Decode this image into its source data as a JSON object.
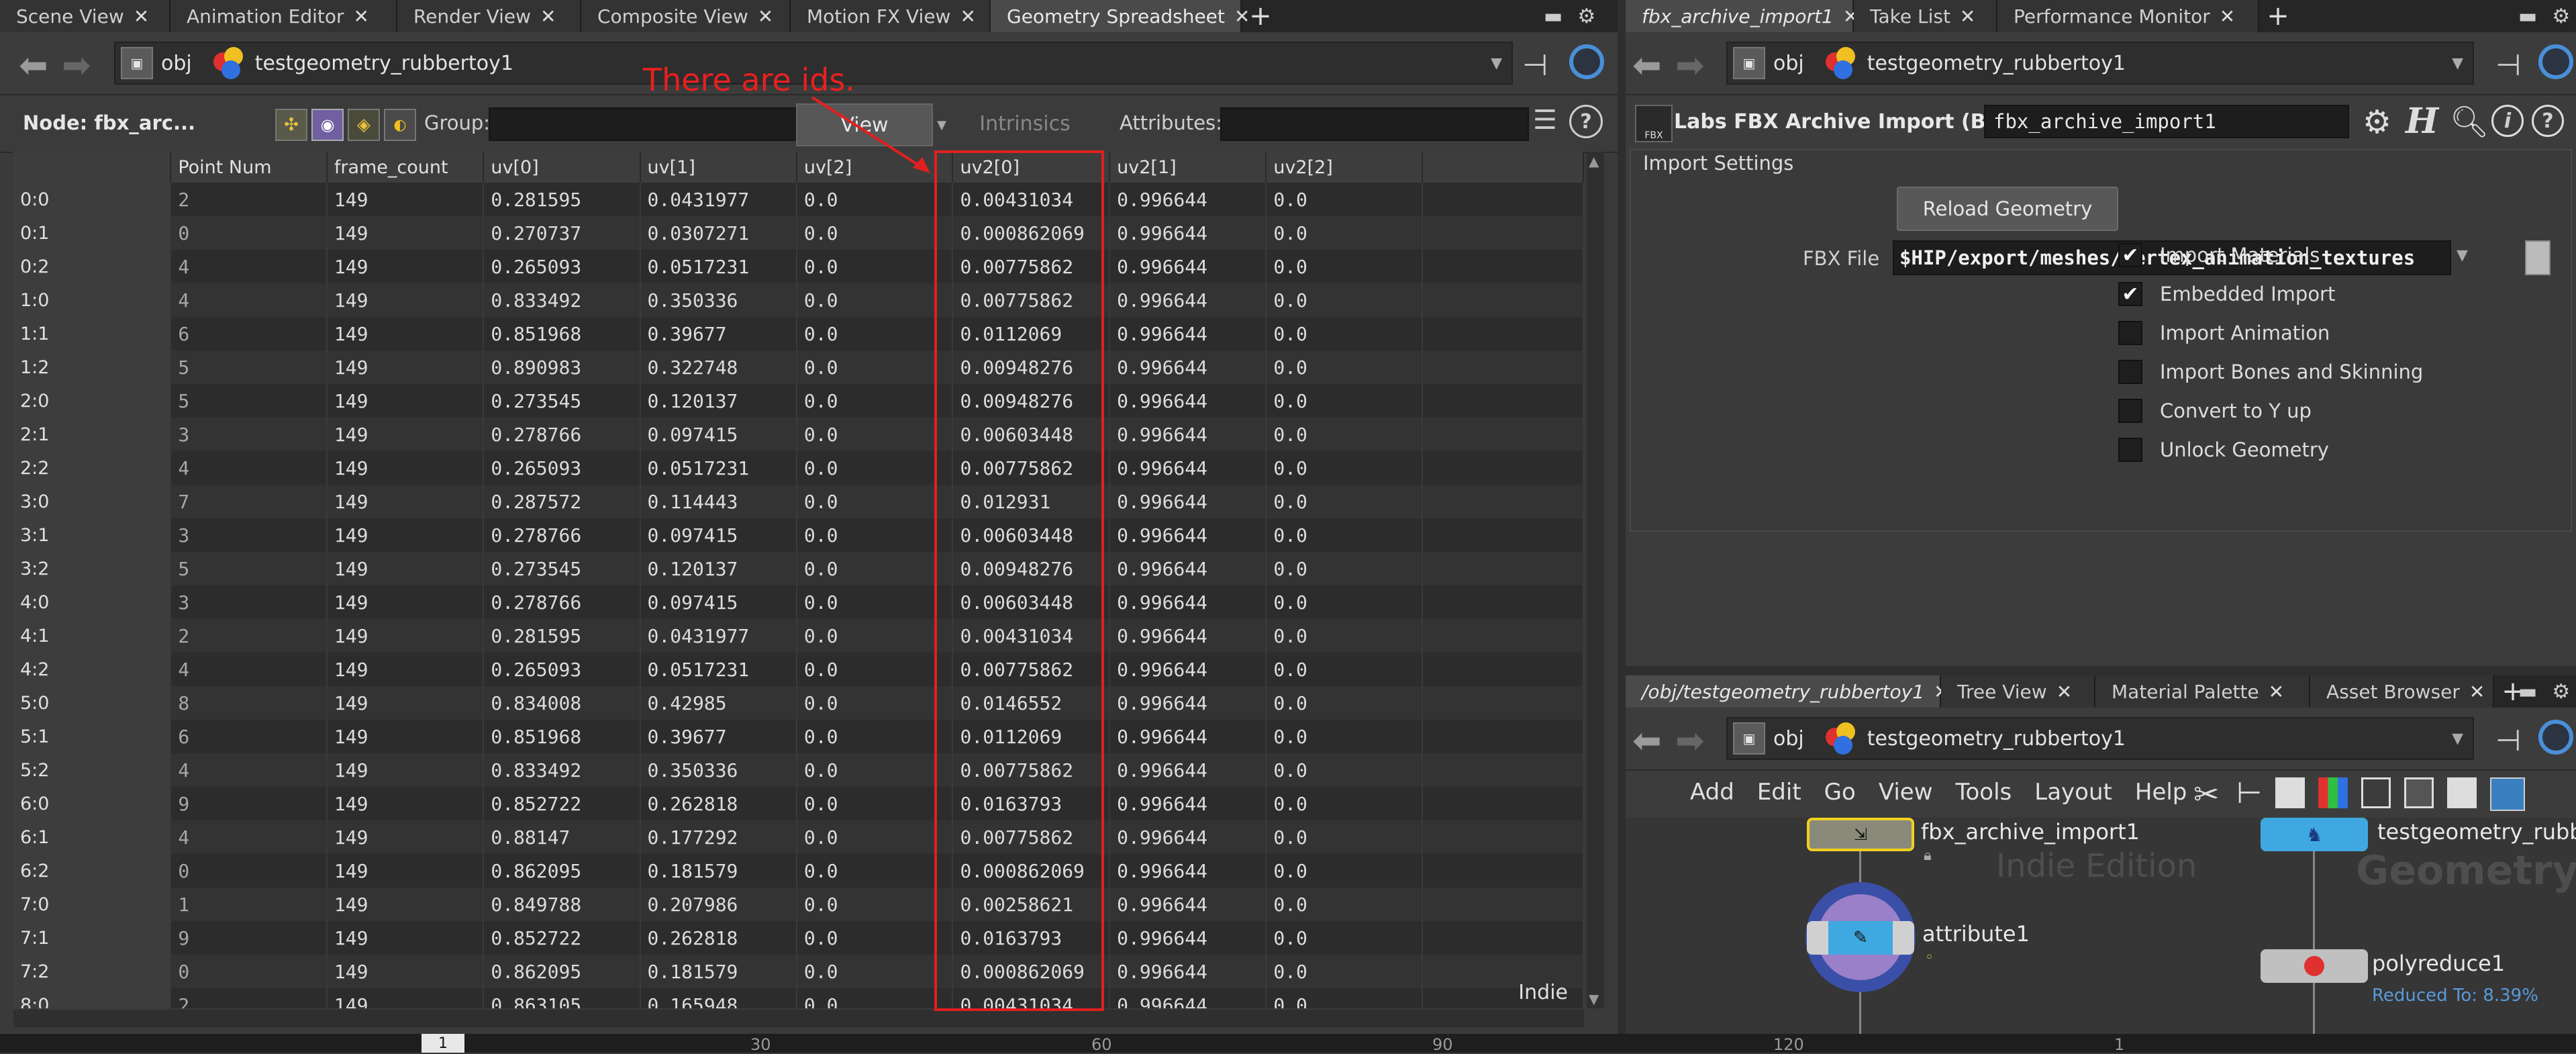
{
  "left": {
    "tabs": [
      {
        "label": "Scene View",
        "active": false
      },
      {
        "label": "Animation Editor",
        "active": false
      },
      {
        "label": "Render View",
        "active": false
      },
      {
        "label": "Composite View",
        "active": false
      },
      {
        "label": "Motion FX View",
        "active": false
      },
      {
        "label": "Geometry Spreadsheet",
        "active": true
      }
    ],
    "path": {
      "root": "obj",
      "node": "testgeometry_rubbertoy1"
    },
    "toolbar": {
      "node_label": "Node: fbx_arc...",
      "group_label": "Group:",
      "group_value": "",
      "view_label": "View",
      "intrinsics_label": "Intrinsics",
      "attributes_label": "Attributes:",
      "attributes_value": ""
    },
    "columns": [
      "",
      "Point Num",
      "frame_count",
      "uv[0]",
      "uv[1]",
      "uv[2]",
      "uv2[0]",
      "uv2[1]",
      "uv2[2]"
    ],
    "rows": [
      [
        "0:0",
        "2",
        "149",
        "0.281595",
        "0.0431977",
        "0.0",
        "0.00431034",
        "0.996644",
        "0.0"
      ],
      [
        "0:1",
        "0",
        "149",
        "0.270737",
        "0.0307271",
        "0.0",
        "0.000862069",
        "0.996644",
        "0.0"
      ],
      [
        "0:2",
        "4",
        "149",
        "0.265093",
        "0.0517231",
        "0.0",
        "0.00775862",
        "0.996644",
        "0.0"
      ],
      [
        "1:0",
        "4",
        "149",
        "0.833492",
        "0.350336",
        "0.0",
        "0.00775862",
        "0.996644",
        "0.0"
      ],
      [
        "1:1",
        "6",
        "149",
        "0.851968",
        "0.39677",
        "0.0",
        "0.0112069",
        "0.996644",
        "0.0"
      ],
      [
        "1:2",
        "5",
        "149",
        "0.890983",
        "0.322748",
        "0.0",
        "0.00948276",
        "0.996644",
        "0.0"
      ],
      [
        "2:0",
        "5",
        "149",
        "0.273545",
        "0.120137",
        "0.0",
        "0.00948276",
        "0.996644",
        "0.0"
      ],
      [
        "2:1",
        "3",
        "149",
        "0.278766",
        "0.097415",
        "0.0",
        "0.00603448",
        "0.996644",
        "0.0"
      ],
      [
        "2:2",
        "4",
        "149",
        "0.265093",
        "0.0517231",
        "0.0",
        "0.00775862",
        "0.996644",
        "0.0"
      ],
      [
        "3:0",
        "7",
        "149",
        "0.287572",
        "0.114443",
        "0.0",
        "0.012931",
        "0.996644",
        "0.0"
      ],
      [
        "3:1",
        "3",
        "149",
        "0.278766",
        "0.097415",
        "0.0",
        "0.00603448",
        "0.996644",
        "0.0"
      ],
      [
        "3:2",
        "5",
        "149",
        "0.273545",
        "0.120137",
        "0.0",
        "0.00948276",
        "0.996644",
        "0.0"
      ],
      [
        "4:0",
        "3",
        "149",
        "0.278766",
        "0.097415",
        "0.0",
        "0.00603448",
        "0.996644",
        "0.0"
      ],
      [
        "4:1",
        "2",
        "149",
        "0.281595",
        "0.0431977",
        "0.0",
        "0.00431034",
        "0.996644",
        "0.0"
      ],
      [
        "4:2",
        "4",
        "149",
        "0.265093",
        "0.0517231",
        "0.0",
        "0.00775862",
        "0.996644",
        "0.0"
      ],
      [
        "5:0",
        "8",
        "149",
        "0.834008",
        "0.42985",
        "0.0",
        "0.0146552",
        "0.996644",
        "0.0"
      ],
      [
        "5:1",
        "6",
        "149",
        "0.851968",
        "0.39677",
        "0.0",
        "0.0112069",
        "0.996644",
        "0.0"
      ],
      [
        "5:2",
        "4",
        "149",
        "0.833492",
        "0.350336",
        "0.0",
        "0.00775862",
        "0.996644",
        "0.0"
      ],
      [
        "6:0",
        "9",
        "149",
        "0.852722",
        "0.262818",
        "0.0",
        "0.0163793",
        "0.996644",
        "0.0"
      ],
      [
        "6:1",
        "4",
        "149",
        "0.88147",
        "0.177292",
        "0.0",
        "0.00775862",
        "0.996644",
        "0.0"
      ],
      [
        "6:2",
        "0",
        "149",
        "0.862095",
        "0.181579",
        "0.0",
        "0.000862069",
        "0.996644",
        "0.0"
      ],
      [
        "7:0",
        "1",
        "149",
        "0.849788",
        "0.207986",
        "0.0",
        "0.00258621",
        "0.996644",
        "0.0"
      ],
      [
        "7:1",
        "9",
        "149",
        "0.852722",
        "0.262818",
        "0.0",
        "0.0163793",
        "0.996644",
        "0.0"
      ],
      [
        "7:2",
        "0",
        "149",
        "0.862095",
        "0.181579",
        "0.0",
        "0.000862069",
        "0.996644",
        "0.0"
      ],
      [
        "8:0",
        "2",
        "149",
        "0.863105",
        "0.165948",
        "0.0",
        "0.00431034",
        "0.996644",
        "0.0"
      ]
    ],
    "annotation": "There are ids.",
    "watermark": "Indie"
  },
  "right_top": {
    "tabs": [
      {
        "label": "fbx_archive_import1",
        "active": true
      },
      {
        "label": "Take List",
        "active": false
      },
      {
        "label": "Performance Monitor",
        "active": false
      }
    ],
    "path": {
      "root": "obj",
      "node": "testgeometry_rubbertoy1"
    },
    "node_type": "Labs FBX Archive Import (Beta)",
    "node_name": "fbx_archive_import1",
    "section": "Import Settings",
    "reload_button": "Reload Geometry",
    "fbx_file_label": "FBX File",
    "fbx_file_value": "$HIP/export/meshes/vertex_animation_textures",
    "checkboxes": [
      {
        "label": "Import Materials",
        "checked": true
      },
      {
        "label": "Embedded Import",
        "checked": true
      },
      {
        "label": "Import Animation",
        "checked": false
      },
      {
        "label": "Import Bones and Skinning",
        "checked": false
      },
      {
        "label": "Convert to Y up",
        "checked": false
      },
      {
        "label": "Unlock Geometry",
        "checked": false
      }
    ]
  },
  "right_bottom": {
    "tabs": [
      {
        "label": "/obj/testgeometry_rubbertoy1",
        "active": true
      },
      {
        "label": "Tree View",
        "active": false
      },
      {
        "label": "Material Palette",
        "active": false
      },
      {
        "label": "Asset Browser",
        "active": false
      }
    ],
    "path": {
      "root": "obj",
      "node": "testgeometry_rubbertoy1"
    },
    "menu": [
      "Add",
      "Edit",
      "Go",
      "View",
      "Tools",
      "Layout",
      "Help"
    ],
    "nodes": {
      "fbx": "fbx_archive_import1",
      "attribute": "attribute1",
      "testgeo": "testgeometry_rubber",
      "polyreduce": "polyreduce1",
      "polyreduce_info": "Reduced To: 8.39%"
    },
    "watermark_edition": "Indie Edition",
    "watermark_context": "Geometry"
  },
  "timeline": {
    "current": "1",
    "ticks": [
      "30",
      "60",
      "90",
      "120",
      "1"
    ]
  },
  "colors": {
    "accent_red": "#e02020",
    "selection_blue": "#4a8fd8"
  }
}
